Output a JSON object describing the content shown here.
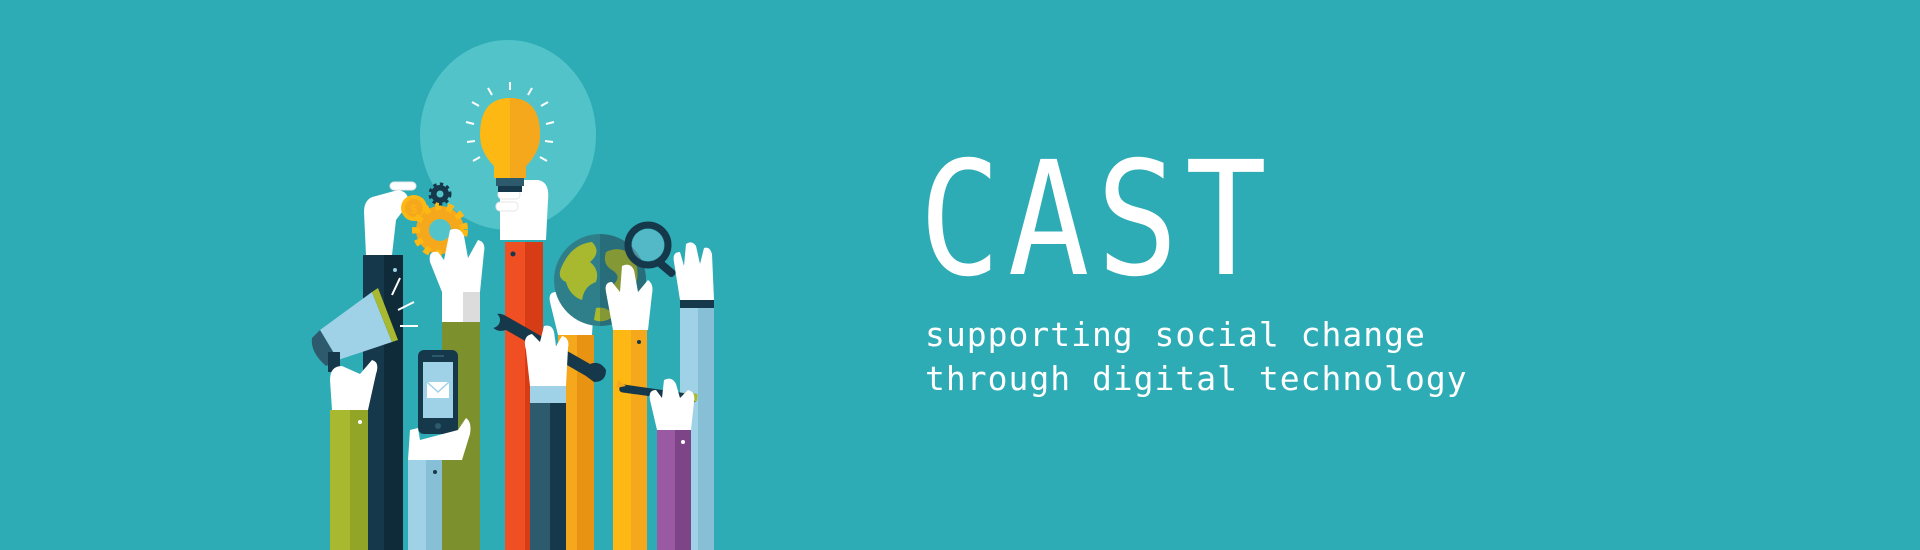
{
  "colors": {
    "background": "#2dacb5",
    "text": "#ffffff",
    "bulb_halo": "#52c4c9",
    "bulb": "#fdb813",
    "orange": "#f04e23",
    "amber": "#f6a81c",
    "lime": "#a9b92f",
    "olive": "#7c912d",
    "navy": "#16384b",
    "slate": "#2e5a6e",
    "sky": "#9fd2e6",
    "purple": "#9a59a3",
    "white": "#ffffff"
  },
  "icons": [
    "lightbulb-icon",
    "gear-icon",
    "coin-icon",
    "megaphone-icon",
    "smartphone-icon",
    "envelope-icon",
    "wrench-icon",
    "globe-icon",
    "magnifier-icon",
    "pen-icon",
    "raised-hand-icon"
  ],
  "brand": {
    "title": "CAST",
    "tagline_line1": "supporting social change",
    "tagline_line2": "through digital technology"
  }
}
